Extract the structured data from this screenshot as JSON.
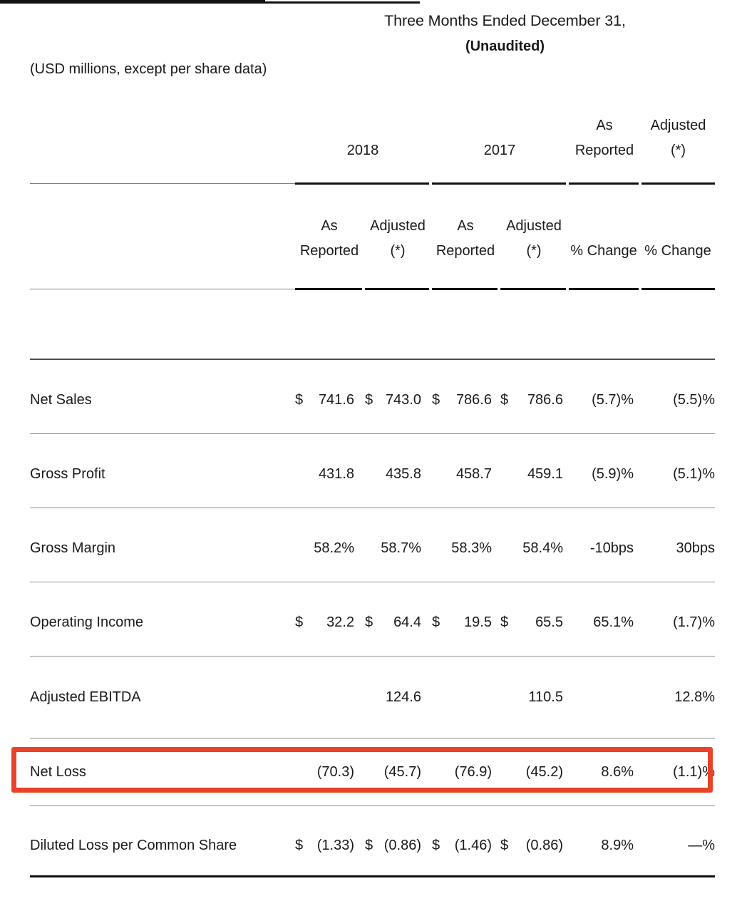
{
  "header": {
    "title": "Three Months Ended December 31,",
    "subtitle": "(Unaudited)",
    "units_note": "(USD millions, except per share data)"
  },
  "columns": {
    "group_year_2018": "2018",
    "group_year_2017": "2017",
    "group_change_as_reported": "As\nReported",
    "group_change_adjusted": "Adjusted\n(*)",
    "sub": [
      "As\nReported",
      "Adjusted\n(*)",
      "As\nReported",
      "Adjusted\n(*)",
      "% Change",
      "% Change"
    ]
  },
  "rows": [
    {
      "label": "Net Sales",
      "currency": [
        "$",
        "$",
        "$",
        "$",
        "",
        ""
      ],
      "values": [
        "741.6",
        "743.0",
        "786.6",
        "786.6",
        "(5.7)%",
        "(5.5)%"
      ],
      "highlighted": false
    },
    {
      "label": "Gross Profit",
      "currency": [
        "",
        "",
        "",
        "",
        "",
        ""
      ],
      "values": [
        "431.8",
        "435.8",
        "458.7",
        "459.1",
        "(5.9)%",
        "(5.1)%"
      ],
      "highlighted": false
    },
    {
      "label": "Gross Margin",
      "currency": [
        "",
        "",
        "",
        "",
        "",
        ""
      ],
      "values": [
        "58.2%",
        "58.7%",
        "58.3%",
        "58.4%",
        "-10bps",
        "30bps"
      ],
      "highlighted": false
    },
    {
      "label": "Operating Income",
      "currency": [
        "$",
        "$",
        "$",
        "$",
        "",
        ""
      ],
      "values": [
        "32.2",
        "64.4",
        "19.5",
        "65.5",
        "65.1%",
        "(1.7)%"
      ],
      "highlighted": false
    },
    {
      "label": "Adjusted EBITDA",
      "currency": [
        "",
        "",
        "",
        "",
        "",
        ""
      ],
      "values": [
        "",
        "124.6",
        "",
        "110.5",
        "",
        "12.8%"
      ],
      "highlighted": false
    },
    {
      "label": "Net Loss",
      "currency": [
        "",
        "",
        "",
        "",
        "",
        ""
      ],
      "values": [
        "(70.3)",
        "(45.7)",
        "(76.9)",
        "(45.2)",
        "8.6%",
        "(1.1)%"
      ],
      "highlighted": true
    },
    {
      "label": "Diluted Loss per Common Share",
      "currency": [
        "$",
        "$",
        "$",
        "$",
        "",
        ""
      ],
      "values": [
        "(1.33)",
        "(0.86)",
        "(1.46)",
        "(0.86)",
        "8.9%",
        "—%"
      ],
      "highlighted": false
    }
  ],
  "style": {
    "highlight_color": "#E8432A",
    "text_color": "#1a1a1a",
    "rule_color": "#111111"
  }
}
